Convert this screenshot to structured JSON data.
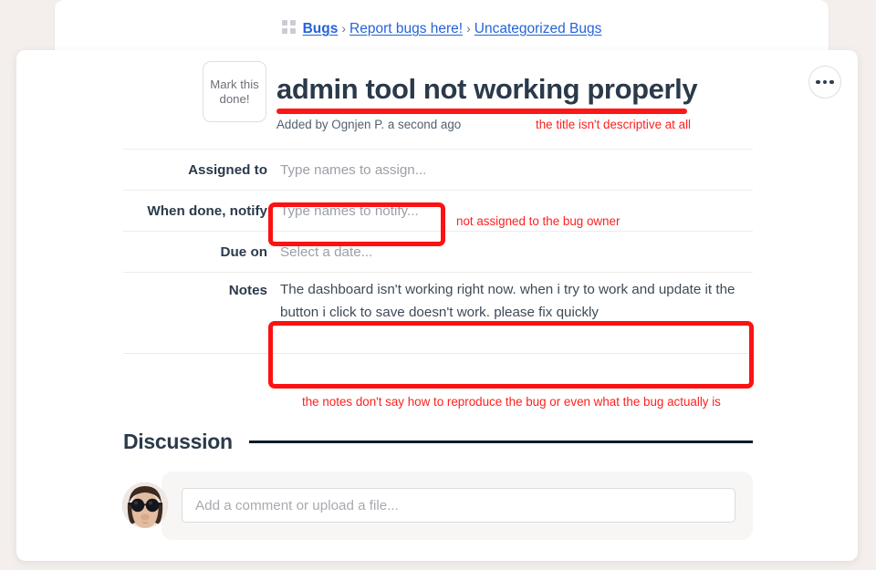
{
  "breadcrumb": {
    "icon": "grid-icon",
    "items": [
      {
        "label": "Bugs",
        "bold": true
      },
      {
        "label": "Report bugs here!",
        "bold": false
      },
      {
        "label": "Uncategorized Bugs",
        "bold": false
      }
    ],
    "separator": "›"
  },
  "card": {
    "more_menu_label": "•••"
  },
  "task": {
    "done_button_label": "Mark this done!",
    "title": "admin tool not working properly",
    "meta": "Added by Ognjen P. a second ago"
  },
  "fields": [
    {
      "label": "Assigned to",
      "value": "Type names to assign...",
      "placeholder": true
    },
    {
      "label": "When done, notify",
      "value": "Type names to notify...",
      "placeholder": true
    },
    {
      "label": "Due on",
      "value": "Select a date...",
      "placeholder": true
    }
  ],
  "notes": {
    "label": "Notes",
    "text": "The dashboard isn't working right now. when i try to work and update it the button i click to save doesn't work. please fix quickly"
  },
  "annotations": {
    "color": "#fd2020",
    "title_note": "the title isn't descriptive at all",
    "assigned_note": "not assigned to the bug owner",
    "notes_note": "the notes don't say how to reproduce the bug or even what the bug actually is"
  },
  "discussion": {
    "heading": "Discussion",
    "comment_placeholder": "Add a comment or upload a file..."
  },
  "colors": {
    "page_background": "#f4efec",
    "card_background": "#ffffff",
    "link": "#2663d9",
    "text_dark": "#2b3a4a",
    "placeholder": "#9b9fa6",
    "annotation_red": "#fd1111",
    "rule_dark": "#0d1b2a"
  }
}
